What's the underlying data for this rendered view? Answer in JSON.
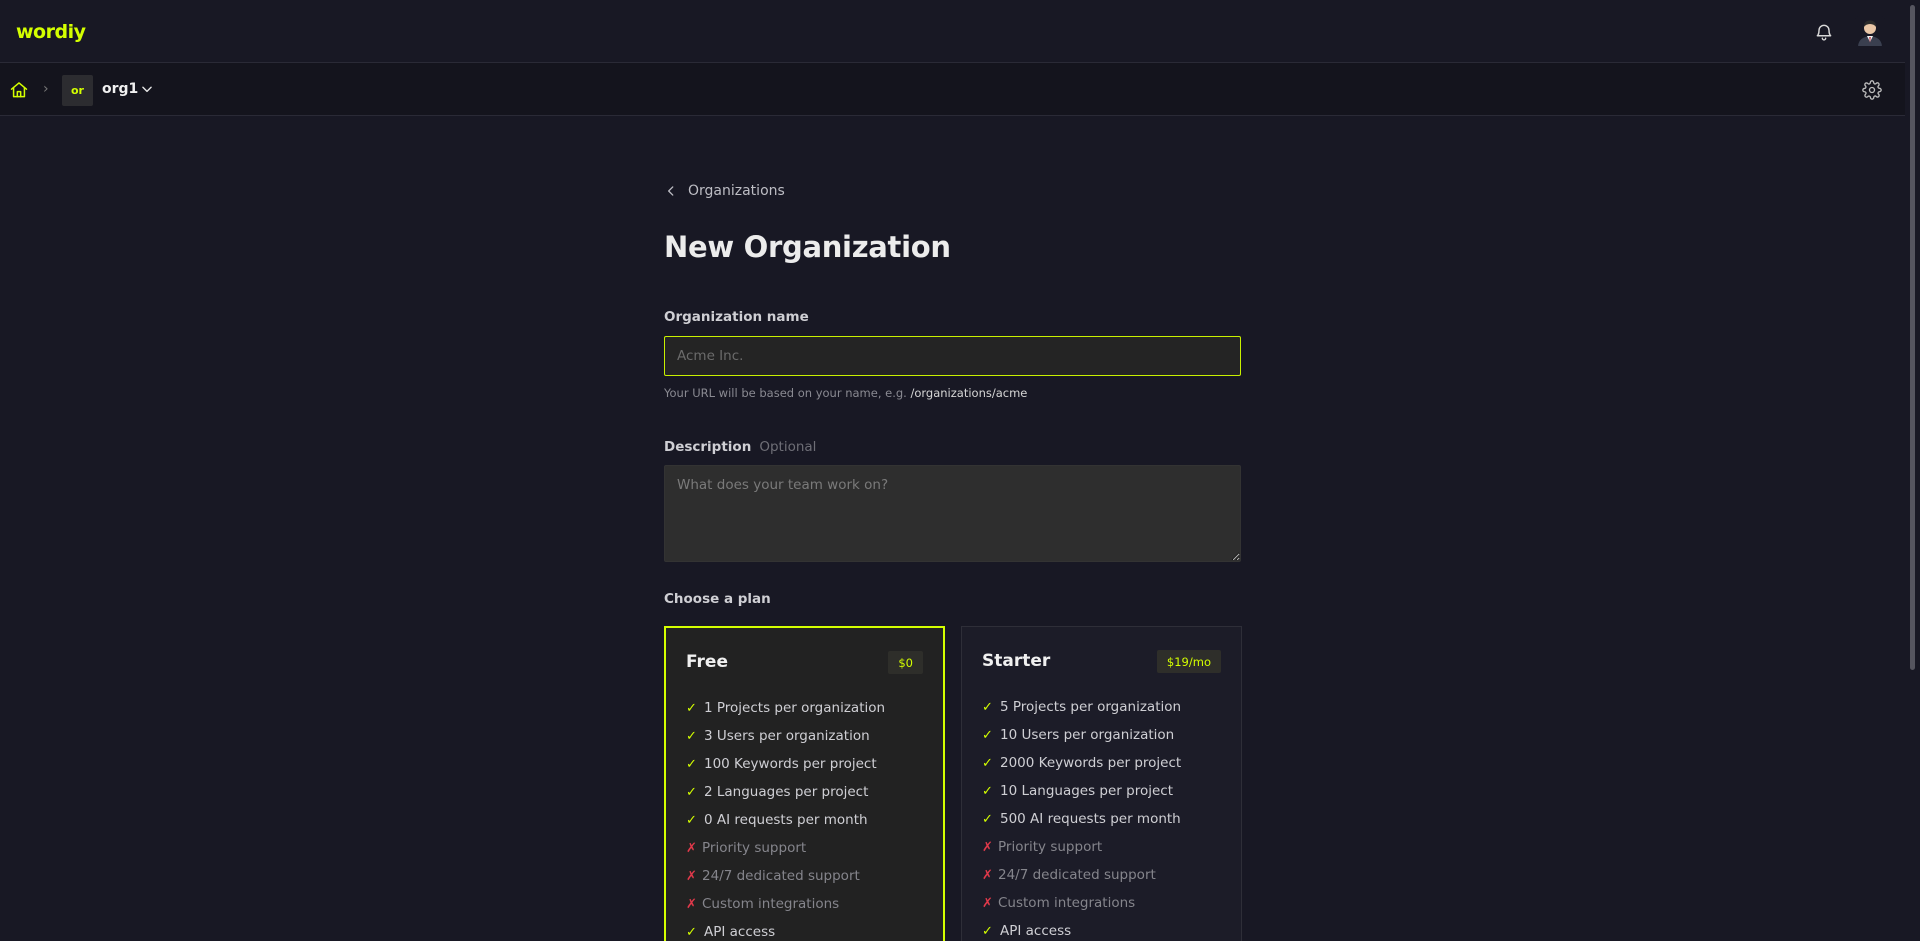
{
  "app": {
    "logo": "wordiy"
  },
  "breadcrumb": {
    "separator": "›",
    "org_badge": "or",
    "org_name": "org1"
  },
  "back_link": {
    "label": "Organizations"
  },
  "page": {
    "title": "New Organization"
  },
  "form": {
    "name_label": "Organization name",
    "name_placeholder": "Acme Inc.",
    "name_value": "",
    "url_hint": "Your URL will be based on your name, e.g. ",
    "url_example": "/organizations/acme",
    "description_label": "Description",
    "description_optional": "Optional",
    "description_placeholder": "What does your team work on?",
    "plan_label": "Choose a plan"
  },
  "plans": [
    {
      "name": "Free",
      "price": "$0",
      "selected": true,
      "features": [
        {
          "text": "1 Projects per organization",
          "included": true
        },
        {
          "text": "3 Users per organization",
          "included": true
        },
        {
          "text": "100 Keywords per project",
          "included": true
        },
        {
          "text": "2 Languages per project",
          "included": true
        },
        {
          "text": "0 AI requests per month",
          "included": true
        },
        {
          "text": "Priority support",
          "included": false
        },
        {
          "text": "24/7 dedicated support",
          "included": false
        },
        {
          "text": "Custom integrations",
          "included": false
        },
        {
          "text": "API access",
          "included": true
        }
      ]
    },
    {
      "name": "Starter",
      "price": "$19/mo",
      "selected": false,
      "features": [
        {
          "text": "5 Projects per organization",
          "included": true
        },
        {
          "text": "10 Users per organization",
          "included": true
        },
        {
          "text": "2000 Keywords per project",
          "included": true
        },
        {
          "text": "10 Languages per project",
          "included": true
        },
        {
          "text": "500 AI requests per month",
          "included": true
        },
        {
          "text": "Priority support",
          "included": false
        },
        {
          "text": "24/7 dedicated support",
          "included": false
        },
        {
          "text": "Custom integrations",
          "included": false
        },
        {
          "text": "API access",
          "included": true
        }
      ]
    }
  ],
  "icons": {
    "check_mark": "✓",
    "cross_mark": "✗"
  },
  "colors": {
    "accent": "#d4ff00",
    "error": "#e0394a",
    "background": "#181824"
  }
}
